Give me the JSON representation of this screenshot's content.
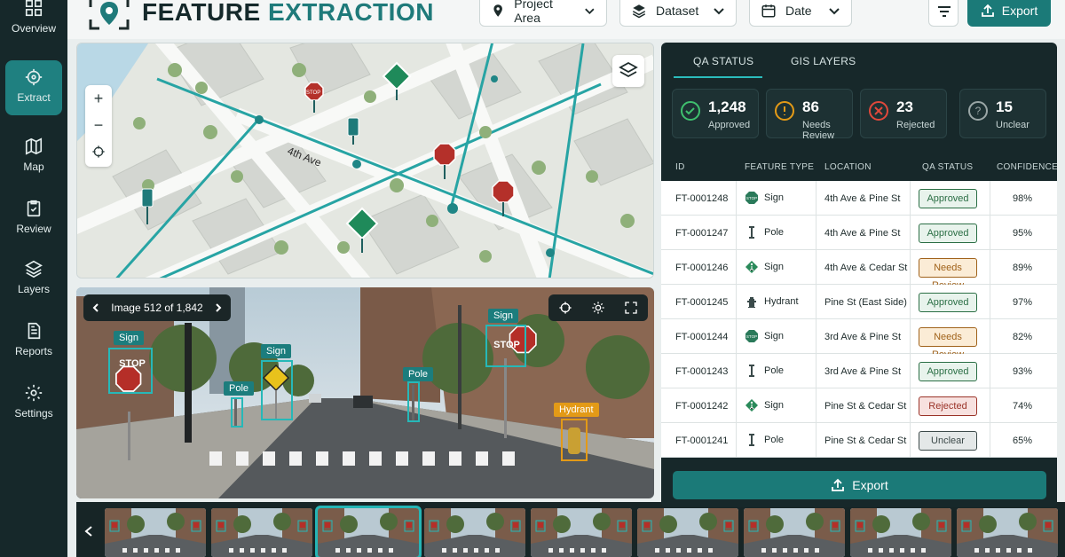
{
  "app": {
    "title_part1": "FEATURE",
    "title_part2": "EXTRACTION"
  },
  "sidebar": {
    "items": [
      {
        "label": "Overview",
        "icon": "grid-icon"
      },
      {
        "label": "Extract",
        "icon": "crosshair-icon",
        "active": true
      },
      {
        "label": "Map",
        "icon": "map-icon"
      },
      {
        "label": "Review",
        "icon": "clipboard-check-icon"
      },
      {
        "label": "Layers",
        "icon": "layers-icon"
      },
      {
        "label": "Reports",
        "icon": "report-icon"
      },
      {
        "label": "Settings",
        "icon": "gear-icon"
      }
    ]
  },
  "filters": {
    "project": "Project Area",
    "dataset": "Dataset",
    "date": "Date"
  },
  "toolbar": {
    "export_label": "Export"
  },
  "map": {
    "street_label": "4th Ave",
    "zoom_in": "+",
    "zoom_out": "−"
  },
  "viewer": {
    "image_counter": "Image 512 of 1,842"
  },
  "detections": [
    {
      "label": "Sign",
      "kind": "stop-sign"
    },
    {
      "label": "Pole",
      "kind": "pole"
    },
    {
      "label": "Sign",
      "kind": "pedestrian-sign"
    },
    {
      "label": "Pole",
      "kind": "pole"
    },
    {
      "label": "Sign",
      "kind": "stop-sign"
    },
    {
      "label": "Hydrant",
      "kind": "hydrant"
    }
  ],
  "stop_text": "STOP",
  "panel": {
    "tabs": [
      "QA STATUS",
      "GIS LAYERS"
    ],
    "stats": [
      {
        "value": "1,248",
        "label": "Approved",
        "color": "#3fbf6e"
      },
      {
        "value": "86",
        "label": "Needs Review",
        "color": "#e39a17"
      },
      {
        "value": "23",
        "label": "Rejected",
        "color": "#e0483b"
      },
      {
        "value": "15",
        "label": "Unclear",
        "color": "#9aa6a6"
      }
    ],
    "columns": [
      "ID",
      "FEATURE TYPE",
      "LOCATION",
      "QA STATUS",
      "CONFIDENCE"
    ],
    "rows": [
      {
        "id": "FT-0001248",
        "type": "Sign",
        "icon": "stop-sign-icon",
        "location": "4th Ave & Pine St",
        "status": "Approved",
        "confidence": "98%"
      },
      {
        "id": "FT-0001247",
        "type": "Pole",
        "icon": "pole-icon",
        "location": "4th Ave & Pine St",
        "status": "Approved",
        "confidence": "95%"
      },
      {
        "id": "FT-0001246",
        "type": "Sign",
        "icon": "pedestrian-sign-icon",
        "location": "4th Ave & Cedar St",
        "status": "Needs Review",
        "confidence": "89%"
      },
      {
        "id": "FT-0001245",
        "type": "Hydrant",
        "icon": "hydrant-icon",
        "location": "Pine St (East Side)",
        "status": "Approved",
        "confidence": "97%"
      },
      {
        "id": "FT-0001244",
        "type": "Sign",
        "icon": "stop-sign-icon",
        "location": "3rd Ave & Pine St",
        "status": "Needs Review",
        "confidence": "82%"
      },
      {
        "id": "FT-0001243",
        "type": "Pole",
        "icon": "pole-icon",
        "location": "3rd Ave & Pine St",
        "status": "Approved",
        "confidence": "93%"
      },
      {
        "id": "FT-0001242",
        "type": "Sign",
        "icon": "pedestrian-sign-icon",
        "location": "Pine St & Cedar St",
        "status": "Rejected",
        "confidence": "74%"
      },
      {
        "id": "FT-0001241",
        "type": "Pole",
        "icon": "pole-icon",
        "location": "Pine St & Cedar St",
        "status": "Unclear",
        "confidence": "65%"
      }
    ],
    "export_label": "Export"
  },
  "filmstrip": {
    "count": 9,
    "selected": 2
  }
}
